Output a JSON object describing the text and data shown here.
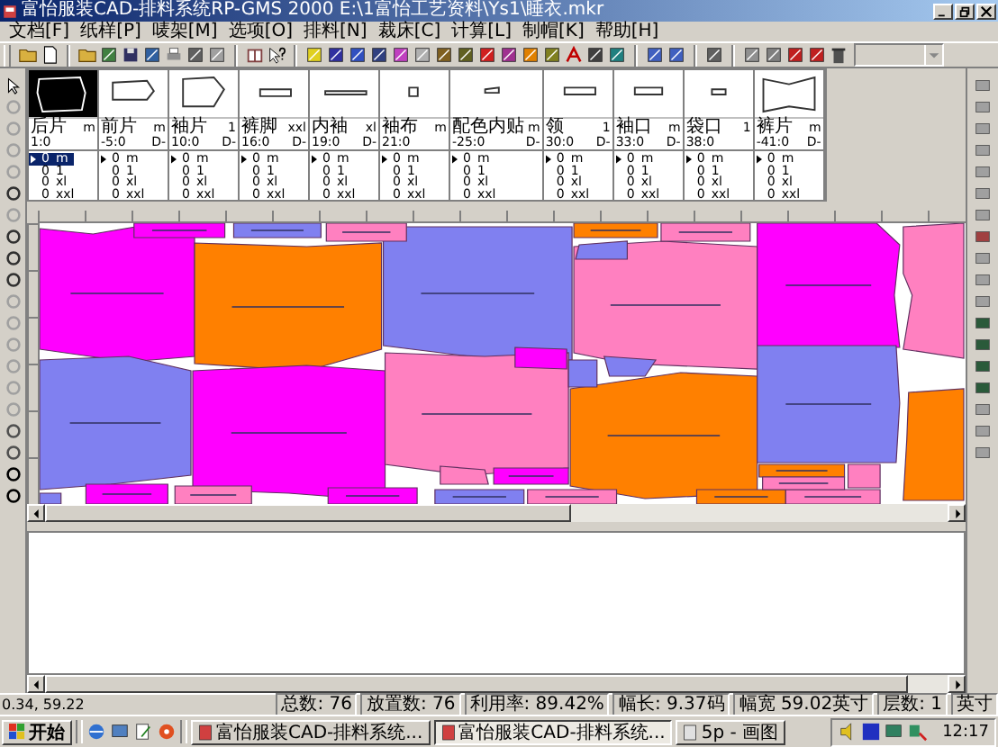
{
  "window": {
    "title": "富怡服装CAD-排料系统RP-GMS 2000 E:\\1富怡工艺资料\\Ys1\\睡衣.mkr"
  },
  "menu": [
    "文档[F]",
    "纸样[P]",
    "唛架[M]",
    "选项[O]",
    "排料[N]",
    "裁床[C]",
    "计算[L]",
    "制帽[K]",
    "帮助[H]"
  ],
  "pieces": [
    {
      "name": "后片",
      "size": "m",
      "position": "1:0",
      "selected": true,
      "sizes": [
        {
          "count": "0",
          "size": "m",
          "current": true,
          "selected": true
        },
        {
          "count": "0",
          "size": "1",
          "current": false,
          "selected": false
        },
        {
          "count": "0",
          "size": "xl",
          "current": false,
          "selected": false
        },
        {
          "count": "0",
          "size": "xxl",
          "current": false,
          "selected": false
        }
      ]
    },
    {
      "name": "前片",
      "size": "m",
      "position": "-5:0",
      "suffix": "D-",
      "selected": false,
      "sizes": [
        {
          "count": "0",
          "size": "m",
          "current": true,
          "selected": false
        },
        {
          "count": "0",
          "size": "1",
          "current": false,
          "selected": false
        },
        {
          "count": "0",
          "size": "xl",
          "current": false,
          "selected": false
        },
        {
          "count": "0",
          "size": "xxl",
          "current": false,
          "selected": false
        }
      ]
    },
    {
      "name": "袖片",
      "size": "1",
      "position": "10:0",
      "suffix": "D-",
      "selected": false,
      "sizes": [
        {
          "count": "0",
          "size": "m",
          "current": true,
          "selected": false
        },
        {
          "count": "0",
          "size": "1",
          "current": false,
          "selected": false
        },
        {
          "count": "0",
          "size": "xl",
          "current": false,
          "selected": false
        },
        {
          "count": "0",
          "size": "xxl",
          "current": false,
          "selected": false
        }
      ]
    },
    {
      "name": "裤脚",
      "size": "xxl",
      "position": "16:0",
      "suffix": "D-",
      "selected": false,
      "sizes": [
        {
          "count": "0",
          "size": "m",
          "current": true,
          "selected": false
        },
        {
          "count": "0",
          "size": "1",
          "current": false,
          "selected": false
        },
        {
          "count": "0",
          "size": "xl",
          "current": false,
          "selected": false
        },
        {
          "count": "0",
          "size": "xxl",
          "current": false,
          "selected": false
        }
      ]
    },
    {
      "name": "内袖",
      "size": "xl",
      "position": "19:0",
      "suffix": "D-",
      "selected": false,
      "sizes": [
        {
          "count": "0",
          "size": "m",
          "current": true,
          "selected": false
        },
        {
          "count": "0",
          "size": "1",
          "current": false,
          "selected": false
        },
        {
          "count": "0",
          "size": "xl",
          "current": false,
          "selected": false
        },
        {
          "count": "0",
          "size": "xxl",
          "current": false,
          "selected": false
        }
      ]
    },
    {
      "name": "袖布",
      "size": "m",
      "position": "21:0",
      "selected": false,
      "sizes": [
        {
          "count": "0",
          "size": "m",
          "current": true,
          "selected": false
        },
        {
          "count": "0",
          "size": "1",
          "current": false,
          "selected": false
        },
        {
          "count": "0",
          "size": "xl",
          "current": false,
          "selected": false
        },
        {
          "count": "0",
          "size": "xxl",
          "current": false,
          "selected": false
        }
      ]
    },
    {
      "name": "配色内贴",
      "size": "m",
      "position": "-25:0",
      "suffix": "D-",
      "selected": false,
      "sizes": [
        {
          "count": "0",
          "size": "m",
          "current": true,
          "selected": false
        },
        {
          "count": "0",
          "size": "1",
          "current": false,
          "selected": false
        },
        {
          "count": "0",
          "size": "xl",
          "current": false,
          "selected": false
        },
        {
          "count": "0",
          "size": "xxl",
          "current": false,
          "selected": false
        }
      ]
    },
    {
      "name": "领",
      "size": "1",
      "position": "30:0",
      "suffix": "D-",
      "selected": false,
      "sizes": [
        {
          "count": "0",
          "size": "m",
          "current": true,
          "selected": false
        },
        {
          "count": "0",
          "size": "1",
          "current": false,
          "selected": false
        },
        {
          "count": "0",
          "size": "xl",
          "current": false,
          "selected": false
        },
        {
          "count": "0",
          "size": "xxl",
          "current": false,
          "selected": false
        }
      ]
    },
    {
      "name": "袖口",
      "size": "m",
      "position": "33:0",
      "suffix": "D-",
      "selected": false,
      "sizes": [
        {
          "count": "0",
          "size": "m",
          "current": true,
          "selected": false
        },
        {
          "count": "0",
          "size": "1",
          "current": false,
          "selected": false
        },
        {
          "count": "0",
          "size": "xl",
          "current": false,
          "selected": false
        },
        {
          "count": "0",
          "size": "xxl",
          "current": false,
          "selected": false
        }
      ]
    },
    {
      "name": "袋口",
      "size": "1",
      "position": "38:0",
      "selected": false,
      "sizes": [
        {
          "count": "0",
          "size": "m",
          "current": true,
          "selected": false
        },
        {
          "count": "0",
          "size": "1",
          "current": false,
          "selected": false
        },
        {
          "count": "0",
          "size": "xl",
          "current": false,
          "selected": false
        },
        {
          "count": "0",
          "size": "xxl",
          "current": false,
          "selected": false
        }
      ]
    },
    {
      "name": "裤片",
      "size": "m",
      "position": "-41:0",
      "suffix": "D-",
      "selected": false,
      "sizes": [
        {
          "count": "0",
          "size": "m",
          "current": true,
          "selected": false
        },
        {
          "count": "0",
          "size": "1",
          "current": false,
          "selected": false
        },
        {
          "count": "0",
          "size": "xl",
          "current": false,
          "selected": false
        },
        {
          "count": "0",
          "size": "xxl",
          "current": false,
          "selected": false
        }
      ]
    }
  ],
  "status_bar": {
    "coordinates": "0.34, 59.22",
    "fields": [
      "总数: 76",
      "放置数: 76",
      "利用率: 89.42%",
      "幅长: 9.37码",
      "幅宽 59.02英寸",
      "层数: 1",
      "英寸"
    ]
  },
  "taskbar": {
    "start": "开始",
    "tasks": [
      {
        "label": "富怡服装CAD-排料系统...",
        "selected": false
      },
      {
        "label": "富怡服装CAD-排料系统...",
        "selected": true
      },
      {
        "label": "5p - 画图",
        "selected": false
      }
    ],
    "clock": "12:17"
  }
}
